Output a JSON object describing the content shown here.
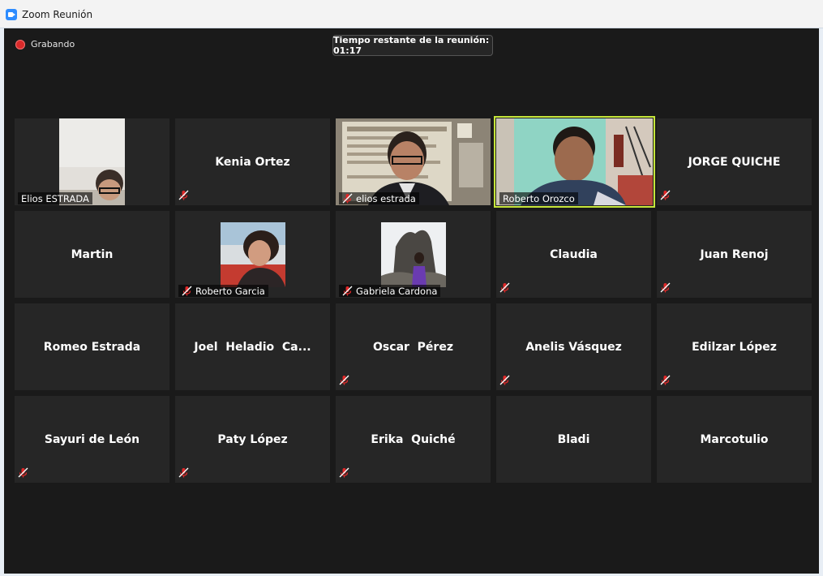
{
  "window": {
    "title": "Zoom Reunión"
  },
  "recording": {
    "label": "Grabando"
  },
  "timer": {
    "text": "Tiempo restante de la reunión: 01:17"
  },
  "participants": [
    {
      "name": "Elios ESTRADA",
      "video": true,
      "muted": false
    },
    {
      "name": "Kenia Ortez",
      "video": false,
      "muted": true
    },
    {
      "name": "elios estrada",
      "video": true,
      "muted": true
    },
    {
      "name": "Roberto Orozco",
      "video": true,
      "muted": false,
      "active": true
    },
    {
      "name": "JORGE QUICHE",
      "video": false,
      "muted": true
    },
    {
      "name": "Martin",
      "video": false,
      "muted": false
    },
    {
      "name": "Roberto Garcia",
      "video": true,
      "muted": true
    },
    {
      "name": "Gabriela Cardona",
      "video": true,
      "muted": true
    },
    {
      "name": "Claudia",
      "video": false,
      "muted": true
    },
    {
      "name": "Juan Renoj",
      "video": false,
      "muted": true
    },
    {
      "name": "Romeo Estrada",
      "video": false,
      "muted": false
    },
    {
      "name": "Joel  Heladio  Ca...",
      "video": false,
      "muted": false
    },
    {
      "name": "Oscar  Pérez",
      "video": false,
      "muted": true
    },
    {
      "name": "Anelis Vásquez",
      "video": false,
      "muted": true
    },
    {
      "name": "Edilzar López",
      "video": false,
      "muted": true
    },
    {
      "name": "Sayuri de León",
      "video": false,
      "muted": true
    },
    {
      "name": "Paty López",
      "video": false,
      "muted": true
    },
    {
      "name": "Erika  Quiché",
      "video": false,
      "muted": true
    },
    {
      "name": "Bladi",
      "video": false,
      "muted": false
    },
    {
      "name": "Marcotulio",
      "video": false,
      "muted": false
    }
  ],
  "colors": {
    "active_border": "#c6e63a",
    "mute_icon": "#e02828",
    "tile_bg": "#262626"
  }
}
